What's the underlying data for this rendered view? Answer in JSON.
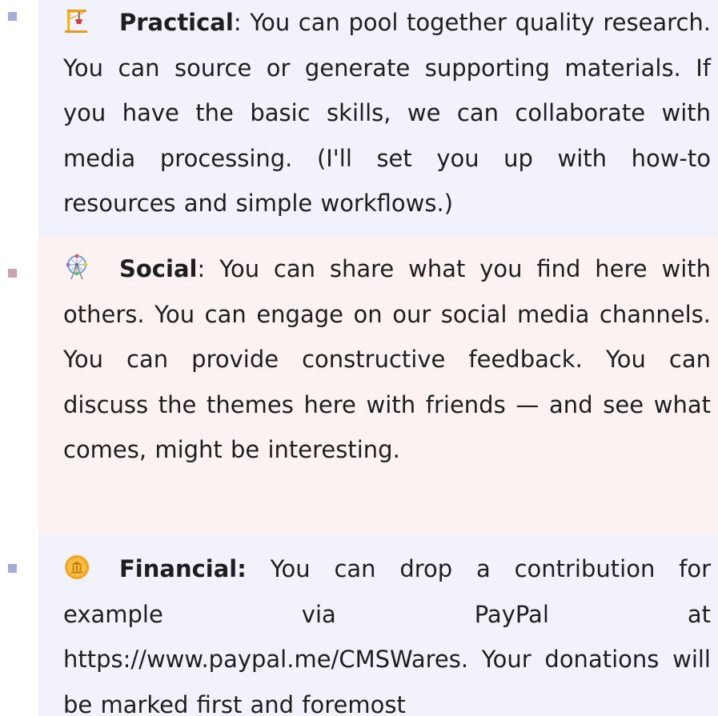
{
  "items": [
    {
      "icon": "crane-icon",
      "label": "Practical",
      "separator": ":",
      "text": " You can pool together quality research. You can source or generate supporting materials. If you have the basic skills, we can collaborate with media processing. (I'll set you up with how-to resources and simple workflows.)"
    },
    {
      "icon": "ferris-wheel-icon",
      "label": "Social",
      "separator": ":",
      "text": " You can share what you find here with others. You can engage on our social media channels. You can provide constructive feedback. You can discuss the themes here with friends — and see what comes, might be interesting."
    },
    {
      "icon": "coin-icon",
      "label": "Financial:",
      "separator": "",
      "text": " You can drop a contribution for example via PayPal at https://www.paypal.me/CMSWares. Your donations will be marked first and foremost"
    }
  ],
  "colors": {
    "blue_background": "#f1f2fb",
    "pink_background": "#fdf2f2",
    "blue_bullet": "#a6aad6",
    "pink_bullet": "#c9a4ac"
  }
}
